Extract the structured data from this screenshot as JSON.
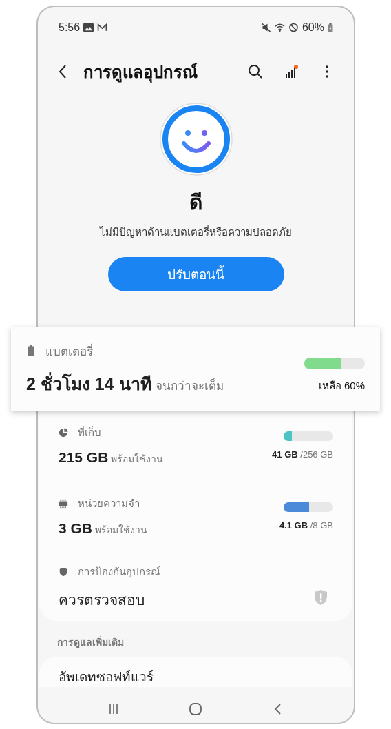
{
  "status_bar": {
    "time": "5:56",
    "battery": "60%"
  },
  "app_bar": {
    "title": "การดูแลอุปกรณ์",
    "notification_dot": true
  },
  "summary": {
    "rating": "ดี",
    "message": "ไม่มีปัญหาด้านแบตเตอรี่หรือความปลอดภัย",
    "button": "ปรับตอนนี้"
  },
  "battery": {
    "label": "แบตเตอรี่",
    "value_parts": [
      "2 ชั่วโมง 14 นาที",
      "จนกว่าจะเต็ม"
    ],
    "level": 0.6,
    "reading": "เหลือ 60%"
  },
  "items": [
    {
      "kind": "meter",
      "label": "ที่เก็บ",
      "value": "215 GB",
      "note": "พร้อมใช้งาน",
      "level": 0.16,
      "color": "#4dc3c3",
      "used": "41 GB",
      "total": "/256 GB"
    },
    {
      "kind": "meter",
      "label": "หน่วยความจำ",
      "value": "3 GB",
      "note": "พร้อมใช้งาน",
      "level": 0.51,
      "color": "#4a8ad8",
      "used": "4.1 GB",
      "total": "/8 GB"
    },
    {
      "kind": "status",
      "label": "การป้องกันอุปกรณ์",
      "value": "ควรตรวจสอบ"
    }
  ],
  "more": {
    "heading": "การดูแลเพิ่มเติม",
    "items": [
      "อัพเดทซอฟท์แวร์"
    ]
  }
}
